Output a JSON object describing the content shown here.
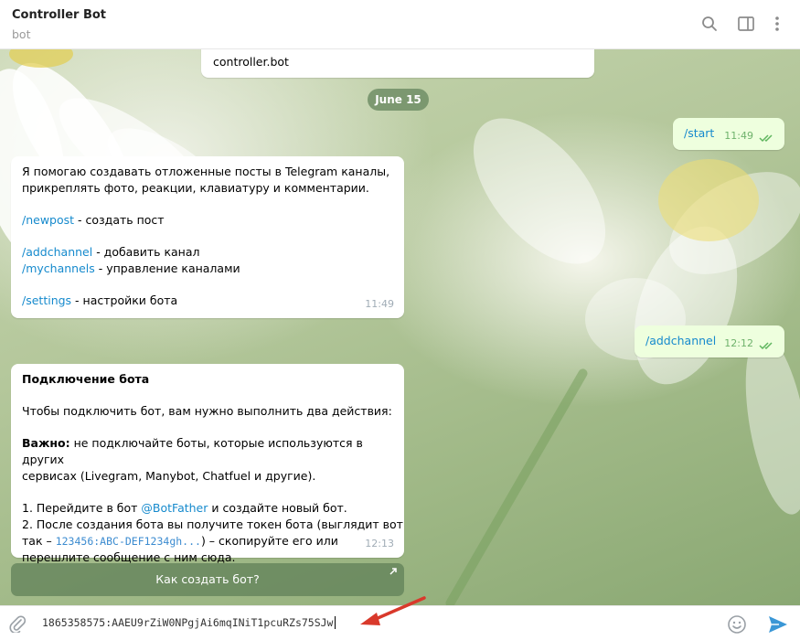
{
  "header": {
    "title": "Controller Bot",
    "subtitle": "bot",
    "icons": [
      "search-icon",
      "sidebar-toggle-icon",
      "more-vertical-icon"
    ]
  },
  "chat": {
    "top_message": {
      "text": "controller.bot"
    },
    "date_separator": "June 15",
    "msg_start": {
      "text": "/start",
      "time": "11:49"
    },
    "msg_help": {
      "line1": "Я помогаю создавать отложенные посты в Telegram каналы,",
      "line2": "прикреплять фото, реакции, клавиатуру и комментарии.",
      "newpost_cmd": "/newpost",
      "newpost_desc": " - создать пост",
      "addchannel_cmd": "/addchannel",
      "addchannel_desc": " - добавить канал",
      "mychannels_cmd": "/mychannels",
      "mychannels_desc": " - управление каналами",
      "settings_cmd": "/settings",
      "settings_desc": " - настройки бота",
      "time": "11:49"
    },
    "msg_addchannel": {
      "text": "/addchannel",
      "time": "12:12"
    },
    "msg_connect": {
      "title": "Подключение бота",
      "intro": "Чтобы подключить бот, вам нужно выполнить два действия:",
      "important_label": "Важно:",
      "important_line1": " не подключайте боты, которые используются в других",
      "important_line2": "сервисах (Livegram, Manybot, Chatfuel и другие).",
      "step1_prefix": "1. Перейдите в бот ",
      "step1_link": "@BotFather",
      "step1_suffix": " и создайте новый бот.",
      "step2_line1": "2. После создания бота вы получите токен бота (выглядит вот",
      "step2_prefix": "так – ",
      "step2_code": "123456:ABC-DEF1234gh...",
      "step2_suffix": ") – скопируйте его или",
      "step2_line3": "перешлите сообщение с ним сюда.",
      "time": "12:13"
    },
    "keyboard_button": {
      "label": "Как создать бот?",
      "icon": "arrow-up-right-icon"
    }
  },
  "input": {
    "value": "1865358575:AAEU9rZiW0NPgjAi6mqINiT1pcuRZs75SJw",
    "icons": [
      "paperclip-icon",
      "emoji-icon",
      "send-icon"
    ]
  },
  "colors": {
    "accent": "#168acd",
    "out_bubble": "#eeffde",
    "check": "#5fb65f",
    "send": "#3a97d6",
    "arrow": "#d9392b"
  }
}
